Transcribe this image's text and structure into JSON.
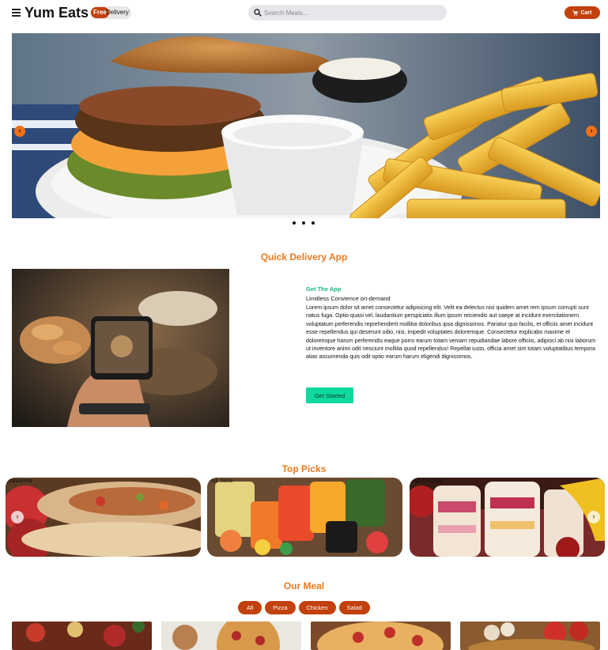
{
  "header": {
    "brand": "Yum Eats",
    "badge_free": "Free",
    "badge_delivery": "Delivery",
    "search_placeholder": "Search Meals...",
    "cart_label": "Cart"
  },
  "hero": {
    "prev_symbol": "‹",
    "next_symbol": "›",
    "slides_count": 3
  },
  "app_section": {
    "title": "Quick Delivery App",
    "eyebrow": "Get The App",
    "subtitle": "Limitless Convience on-demand",
    "body": "Lorem ipsum dolor sit amet consectetur adipisicing elit. Velit ea delectus nisi quidem amet rem ipsum corrupti sunt natus fuga. Optio quasi vel, laudantium perspiciatis illum ipsum reiciendis aut saepe at incidunt exercitationem voluptatum perferendis reprehenderit mollitia doloribus ipsa dignissimos. Pariatur quo facilis, et officiis amet incidunt esse repellendus qui deserunt odio, nisi, impedit voluptates doloremque. Consectetur explicabo maxime et doloremque harum perferendis eaque porro earum totam veniam repudiandae labore officiis, adipisci ab nisi laborum ut inventore animi odit nesciunt mollitia quod repellendus! Repellat iusto, officia amet sint totam voluptatibus tempora alias assumenda quis odit optio earum harum eligendi dignissimos.",
    "button": "Get Started"
  },
  "top_picks": {
    "title": "Top Picks",
    "items": [
      {
        "label": "Shawarma"
      },
      {
        "label": "Fruit Juice"
      },
      {
        "label": "Yogurt Parfait"
      }
    ],
    "prev_symbol": "‹",
    "next_symbol": "›"
  },
  "our_meal": {
    "title": "Our Meal",
    "filters": [
      "All",
      "Pizza",
      "Chicken",
      "Salad"
    ]
  },
  "colors": {
    "accent_orange": "#c2410c",
    "title_orange": "#ea7a1e",
    "green": "#10d9a0"
  }
}
